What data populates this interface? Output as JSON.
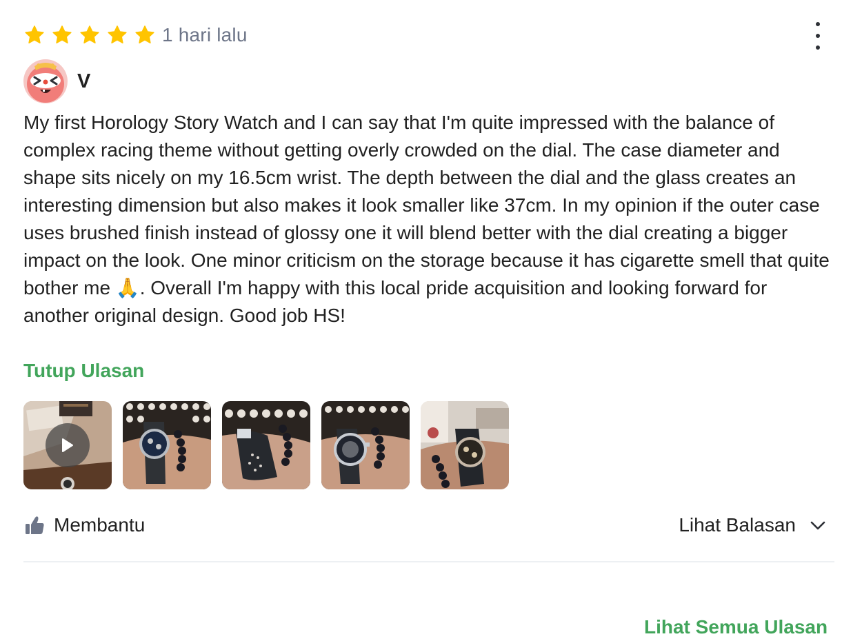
{
  "review": {
    "rating": 5,
    "rating_max": 5,
    "time_ago": "1 hari lalu",
    "more_menu_icon": "more-vertical-icon",
    "user": {
      "name": "V",
      "avatar_icon": "pink-character-avatar"
    },
    "text": "My first Horology Story Watch and I can say that I'm quite impressed with the balance of complex racing theme without getting overly crowded on the dial. The case diameter and shape sits nicely on my 16.5cm wrist. The depth between the dial and the glass creates an interesting dimension but also makes it look smaller like 37cm. In my opinion if the outer case uses brushed finish instead of glossy one it will blend better with the dial creating a bigger impact on the look. One minor criticism on the storage because it has cigarette smell that quite bother me 🙏. Overall I'm happy with this local pride acquisition and looking forward for another original design. Good job HS!",
    "collapse_label": "Tutup Ulasan",
    "media": [
      {
        "type": "video",
        "description": "video-thumbnail"
      },
      {
        "type": "image",
        "description": "watch-on-wrist-photo"
      },
      {
        "type": "image",
        "description": "watch-on-wrist-photo"
      },
      {
        "type": "image",
        "description": "watch-on-wrist-photo"
      },
      {
        "type": "image",
        "description": "watch-on-wrist-photo"
      }
    ],
    "helpful_label": "Membantu",
    "helpful_icon": "thumbs-up-icon",
    "replies_label": "Lihat Balasan",
    "replies_icon": "chevron-down-icon"
  },
  "footer": {
    "see_all_label": "Lihat Semua Ulasan"
  },
  "colors": {
    "accent_green": "#42a55b",
    "star_yellow": "#ffc400",
    "muted_text": "#6d7588",
    "icon_gray": "#6d7588",
    "divider": "#edf0f3"
  }
}
